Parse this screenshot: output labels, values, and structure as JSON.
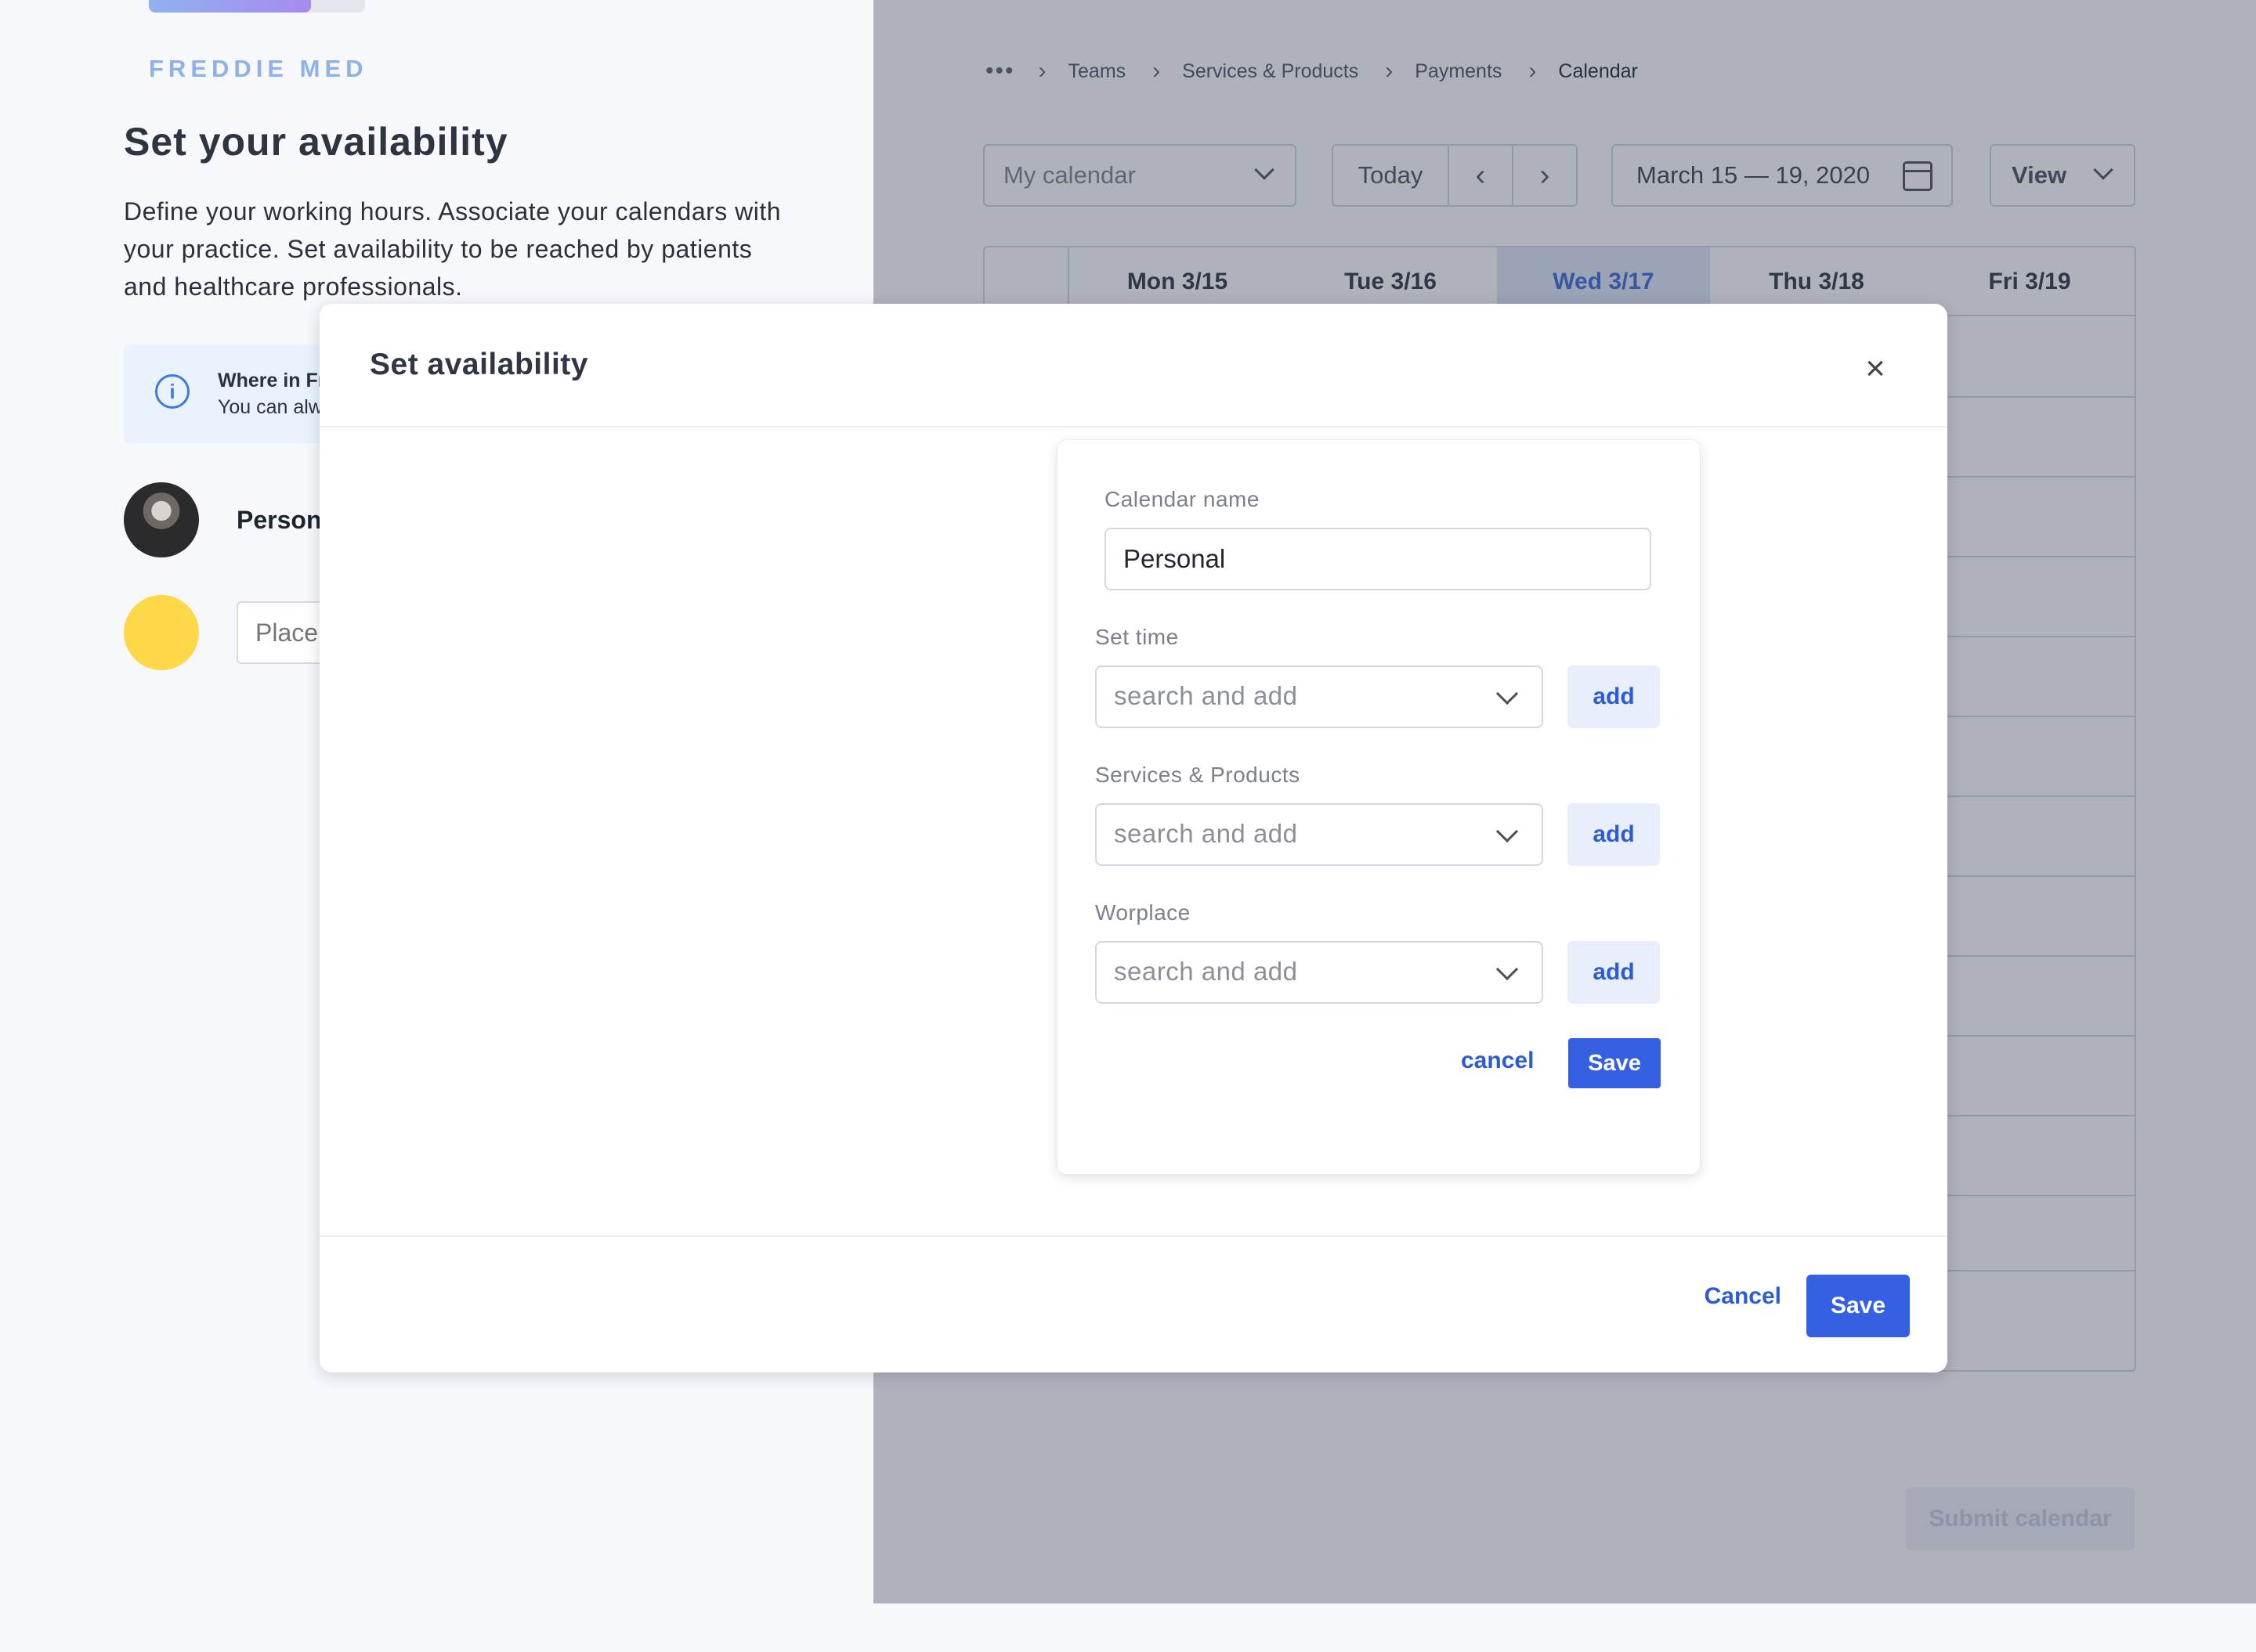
{
  "onboarding": {
    "progress_fraction": 0.75,
    "logo_text": "FREDDIE MED",
    "title": "Set your availability",
    "description": "Define your working hours. Associate your calendars with your practice. Set availability to be reached by patients and healthcare professionals.",
    "info_title": "Where in Fr",
    "info_sub": "You can alw",
    "calendar_label": "Person",
    "place_placeholder": "Place"
  },
  "calendar": {
    "breadcrumb": [
      "Teams",
      "Services & Products",
      "Payments",
      "Calendar"
    ],
    "breadcrumb_more": "•••",
    "calendar_select": "My calendar",
    "today_label": "Today",
    "prev_icon": "chevron-left-icon",
    "next_icon": "chevron-right-icon",
    "date_range": "March 15 — 19, 2020",
    "view_label": "View",
    "days": [
      {
        "label": "Mon 3/15",
        "active": false
      },
      {
        "label": "Tue 3/16",
        "active": false
      },
      {
        "label": "Wed 3/17",
        "active": true
      },
      {
        "label": "Thu 3/18",
        "active": false
      },
      {
        "label": "Fri 3/19",
        "active": false
      }
    ],
    "submit_label": "Submit calendar"
  },
  "modal": {
    "title": "Set availability",
    "close_icon": "close-icon",
    "cancel_label": "Cancel",
    "save_label": "Save"
  },
  "form": {
    "calendar_name_label": "Calendar name",
    "calendar_name_value": "Personal",
    "fields": [
      {
        "label": "Set time",
        "placeholder": "search and add",
        "add_label": "add"
      },
      {
        "label": "Services & Products",
        "placeholder": "search and add",
        "add_label": "add"
      },
      {
        "label": "Worplace",
        "placeholder": "search and add",
        "add_label": "add"
      }
    ],
    "cancel_label": "cancel",
    "save_label": "Save"
  },
  "colors": {
    "accent": "#3560e2",
    "link": "#2c5bd4",
    "active_day_bg": "#dde6f8",
    "overlay": "#3a3e54"
  }
}
